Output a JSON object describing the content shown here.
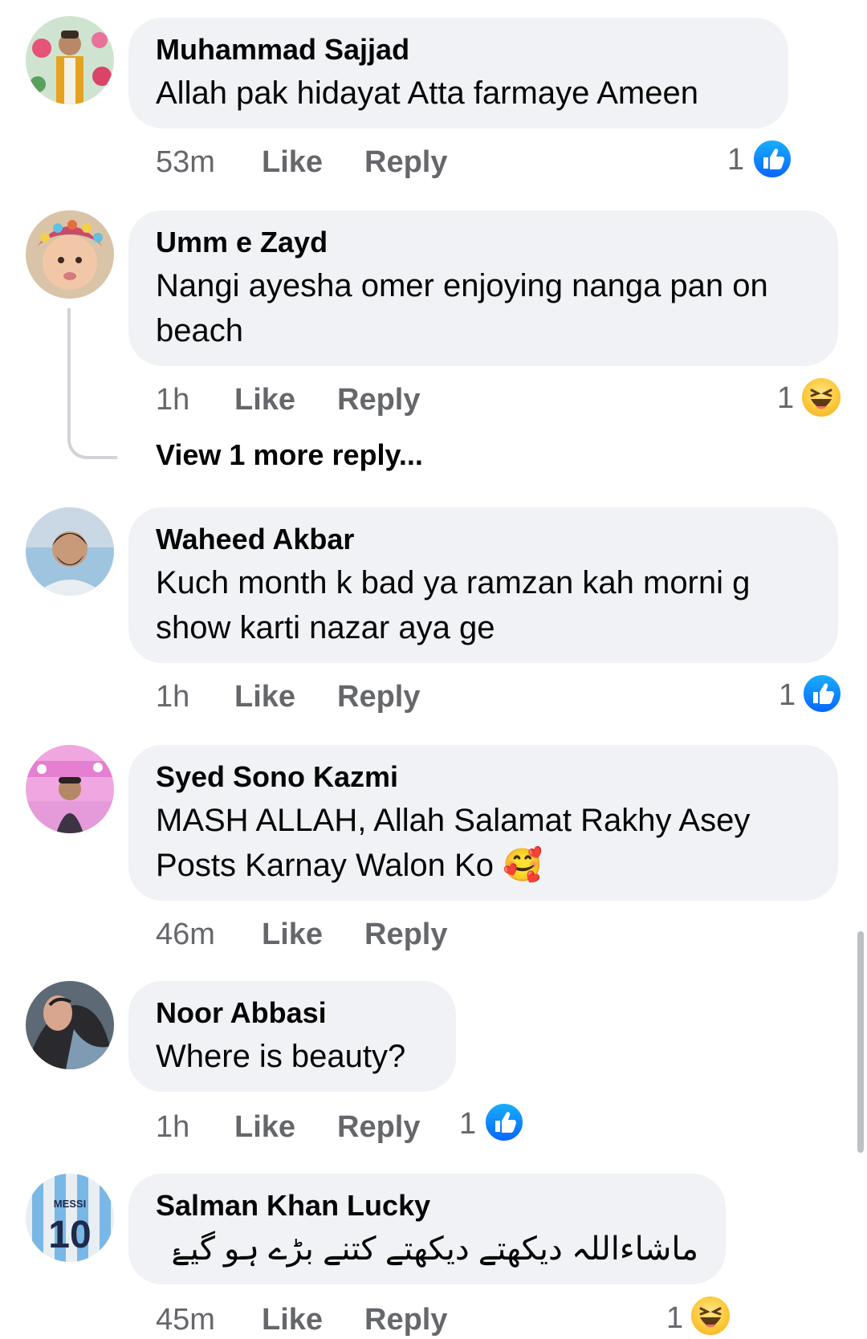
{
  "comments": [
    {
      "name": "Muhammad Sajjad",
      "text": "Allah pak hidayat Atta farmaye Ameen",
      "time": "53m",
      "like": "Like",
      "reply": "Reply",
      "reaction_count": "1",
      "reaction": "like"
    },
    {
      "name": "Umm e Zayd",
      "text": "Nangi ayesha omer enjoying nanga pan on beach",
      "time": "1h",
      "like": "Like",
      "reply": "Reply",
      "reaction_count": "1",
      "reaction": "haha",
      "view_more": "View 1 more reply..."
    },
    {
      "name": "Waheed Akbar",
      "text": "Kuch month k bad ya ramzan kah morni g show karti nazar aya ge",
      "time": "1h",
      "like": "Like",
      "reply": "Reply",
      "reaction_count": "1",
      "reaction": "like"
    },
    {
      "name": "Syed Sono Kazmi",
      "text": "MASH ALLAH, Allah Salamat Rakhy Asey Posts Karnay Walon Ko 🥰",
      "time": "46m",
      "like": "Like",
      "reply": "Reply"
    },
    {
      "name": "Noor Abbasi",
      "text": "Where is beauty?",
      "time": "1h",
      "like": "Like",
      "reply": "Reply",
      "reaction_count": "1",
      "reaction": "like"
    },
    {
      "name": "Salman Khan Lucky",
      "text": "ماشاءاللہ  دیکھتے دیکھتے کتنے بڑے ہو گیۓ",
      "time": "45m",
      "like": "Like",
      "reply": "Reply",
      "reaction_count": "1",
      "reaction": "haha",
      "avatar_jersey_text": "MESSI",
      "avatar_jersey_number": "10"
    }
  ],
  "colors": {
    "bubble": "#f0f2f5",
    "meta_text": "#65676b",
    "like_blue": "#0866ff",
    "haha_yellow": "#fcc93a"
  }
}
